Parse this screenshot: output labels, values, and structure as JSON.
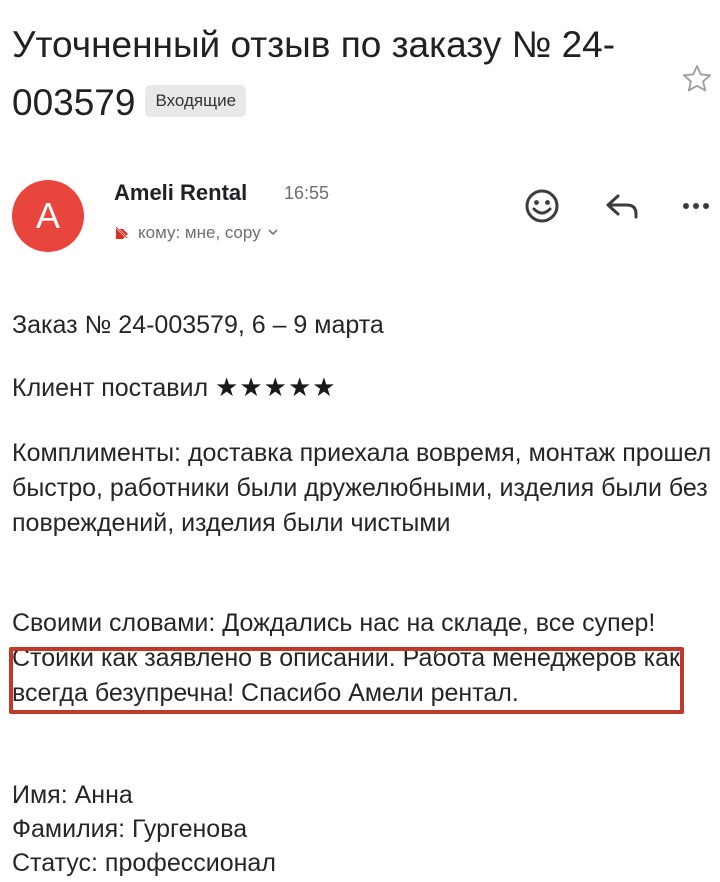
{
  "email": {
    "subject": "Уточненный отзыв по заказу № 24-003579",
    "label": "Входящие",
    "sender": {
      "initial": "A",
      "name": "Ameli Rental",
      "time": "16:55",
      "recipients": "кому: мне, copy"
    },
    "icons": {
      "star": "star-outline-icon",
      "emoji": "smiley-icon",
      "reply": "reply-icon",
      "more": "more-dots-icon",
      "tag": "label-tag-icon"
    },
    "colors": {
      "avatar": "#e8453c",
      "highlight_border": "#c0392b",
      "label_chip_bg": "#e8e8e8"
    }
  },
  "body": {
    "order_line": "Заказ № 24-003579, 6 – 9 марта",
    "rating_prefix": "Клиент поставил",
    "rating_stars": "★★★★★",
    "rating_value": 5,
    "compliments": "Комплименты: доставка приехала вовремя, монтаж прошел быстро, работники были дружелюбными, изделия были без повреждений, изделия были чистыми",
    "own_words": "Своими словами: Дождались нас на складе, все супер! Стойки как заявлено в описании. Работа менеджеров как всегда безупречна! Спасибо Амели рентал.",
    "first_name": "Имя: Анна",
    "last_name": "Фамилия: Гургенова",
    "status": "Статус: профессионал"
  }
}
